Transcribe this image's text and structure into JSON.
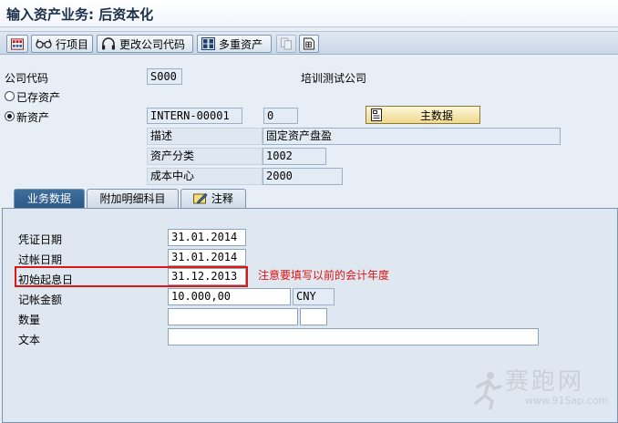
{
  "window": {
    "title": "输入资产业务: 后资本化"
  },
  "toolbar": {
    "line_items_label": "行项目",
    "change_company_label": "更改公司代码",
    "multiple_assets_label": "多重资产"
  },
  "header": {
    "company_code_label": "公司代码",
    "company_code_value": "S000",
    "company_name": "培训测试公司",
    "existing_asset_label": "已存资产",
    "new_asset_label": "新资产",
    "asset_number": "INTERN-00001",
    "sub_number": "0",
    "master_data_label": "主数据",
    "description_label": "描述",
    "description_value": "固定资产盘盈",
    "asset_class_label": "资产分类",
    "asset_class_value": "1002",
    "cost_center_label": "成本中心",
    "cost_center_value": "2000"
  },
  "tabs": [
    {
      "label": "业务数据",
      "active": true
    },
    {
      "label": "附加明细科目",
      "active": false
    },
    {
      "label": "注释",
      "active": false
    }
  ],
  "business": {
    "doc_date_label": "凭证日期",
    "doc_date_value": "31.01.2014",
    "posting_date_label": "过帐日期",
    "posting_date_value": "31.01.2014",
    "value_date_label": "初始起息日",
    "value_date_value": "31.12.2013",
    "amount_label": "记帐金额",
    "amount_value": "10.000,00",
    "currency": "CNY",
    "quantity_label": "数量",
    "quantity_value": "",
    "unit_value": "",
    "text_label": "文本",
    "text_value": ""
  },
  "annotation": {
    "note": "注意要填写以前的会计年度"
  },
  "watermark": {
    "brand": "赛跑网",
    "url": "www.91Sap.com"
  },
  "colors": {
    "annotation": "#e01010",
    "active_tab": "#2b5785",
    "master_button": "#efd98d"
  }
}
